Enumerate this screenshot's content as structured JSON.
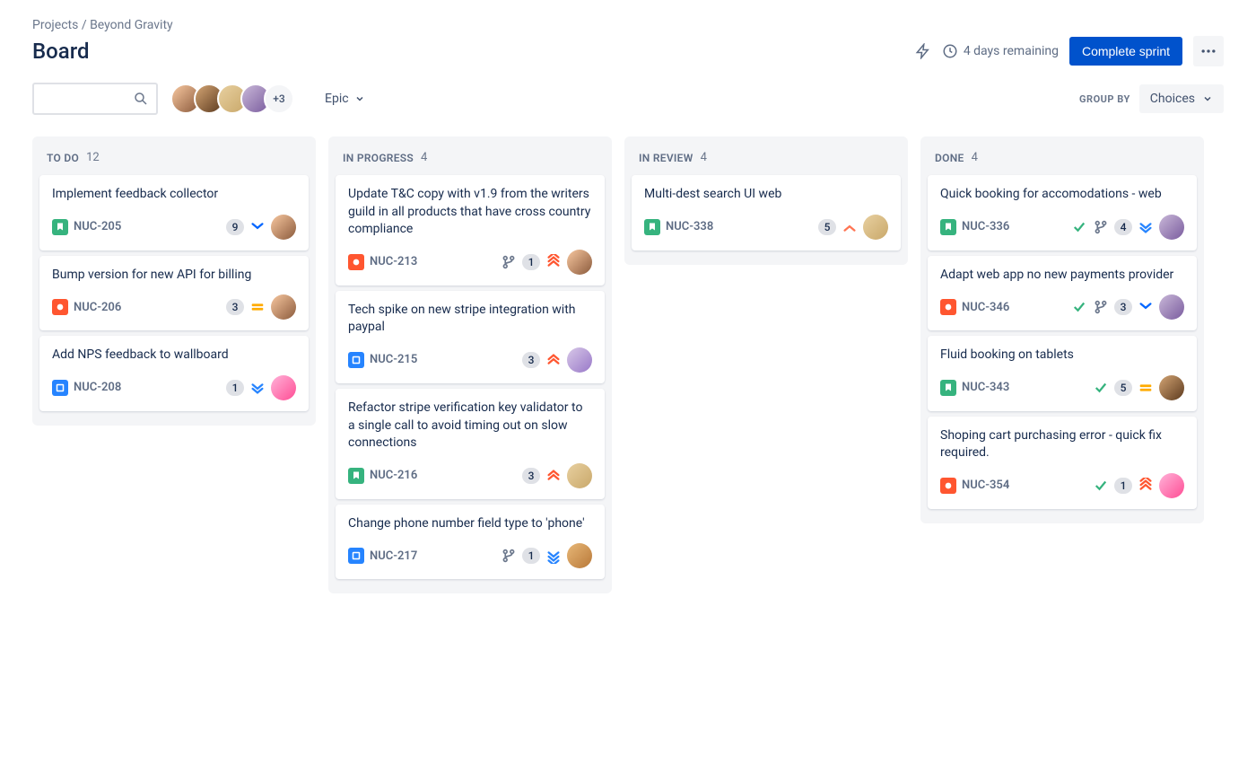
{
  "breadcrumb": {
    "projects": "Projects",
    "project_name": "Beyond Gravity"
  },
  "page_title": "Board",
  "header": {
    "time_remaining": "4 days remaining",
    "complete_sprint": "Complete sprint"
  },
  "toolbar": {
    "avatar_overflow": "+3",
    "epic_label": "Epic",
    "group_by_label": "GROUP BY",
    "choices_label": "Choices"
  },
  "columns": [
    {
      "title": "TO DO",
      "count": "12",
      "cards": [
        {
          "title": "Implement feedback collector",
          "type": "story",
          "key": "NUC-205",
          "badge": "9",
          "priority": "low",
          "avatar": "a1"
        },
        {
          "title": "Bump version for new API for billing",
          "type": "bug",
          "key": "NUC-206",
          "badge": "3",
          "priority": "medium",
          "avatar": "a1"
        },
        {
          "title": "Add NPS feedback to wallboard",
          "type": "task",
          "key": "NUC-208",
          "badge": "1",
          "priority": "lowest",
          "avatar": "a5"
        }
      ]
    },
    {
      "title": "IN PROGRESS",
      "count": "4",
      "cards": [
        {
          "title": "Update T&C copy with v1.9 from the writers guild in all products that have cross country compliance",
          "type": "bug",
          "key": "NUC-213",
          "branch": true,
          "badge": "1",
          "priority": "highest",
          "avatar": "a1"
        },
        {
          "title": "Tech spike on new stripe integration with paypal",
          "type": "task",
          "key": "NUC-215",
          "badge": "3",
          "priority": "high",
          "avatar": "a6"
        },
        {
          "title": "Refactor stripe verification key validator to a single call to avoid timing out on slow connections",
          "type": "story",
          "key": "NUC-216",
          "badge": "3",
          "priority": "high",
          "avatar": "a3"
        },
        {
          "title": "Change phone number field type to 'phone'",
          "type": "task",
          "key": "NUC-217",
          "branch": true,
          "badge": "1",
          "priority": "lowest-blue",
          "avatar": "a7"
        }
      ]
    },
    {
      "title": "IN REVIEW",
      "count": "4",
      "cards": [
        {
          "title": "Multi-dest search UI web",
          "type": "story",
          "key": "NUC-338",
          "badge": "5",
          "priority": "high-single",
          "avatar": "a3"
        }
      ]
    },
    {
      "title": "DONE",
      "count": "4",
      "cards": [
        {
          "title": "Quick booking for accomodations - web",
          "type": "story",
          "key": "NUC-336",
          "check": true,
          "branch": true,
          "badge": "4",
          "priority": "lowest",
          "avatar": "a4"
        },
        {
          "title": "Adapt web app no new payments provider",
          "type": "bug",
          "key": "NUC-346",
          "check": true,
          "branch": true,
          "badge": "3",
          "priority": "low",
          "avatar": "a4"
        },
        {
          "title": "Fluid booking on tablets",
          "type": "story",
          "key": "NUC-343",
          "check": true,
          "badge": "5",
          "priority": "medium",
          "avatar": "a2"
        },
        {
          "title": "Shoping cart purchasing error - quick fix required.",
          "type": "bug",
          "key": "NUC-354",
          "check": true,
          "badge": "1",
          "priority": "highest",
          "avatar": "a5"
        }
      ]
    }
  ],
  "avatar_colors": {
    "a1": "linear-gradient(135deg,#f8c8a0,#8b5a3c)",
    "a2": "linear-gradient(135deg,#d4a574,#5c3a1e)",
    "a3": "linear-gradient(135deg,#e8d0a0,#c9a86a)",
    "a4": "linear-gradient(135deg,#c9b8d8,#7a5c9e)",
    "a5": "linear-gradient(135deg,#ffb3d9,#ff4d94)",
    "a6": "linear-gradient(135deg,#d8c8e8,#9878c8)",
    "a7": "linear-gradient(135deg,#e8b878,#b87838)"
  }
}
